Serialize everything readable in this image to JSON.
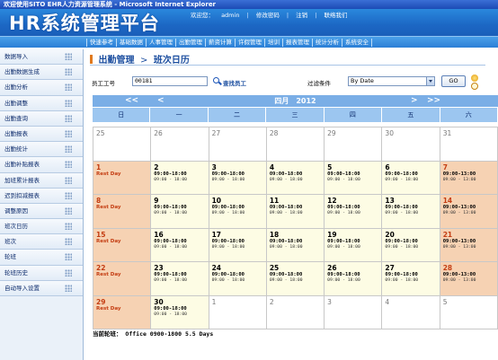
{
  "window": {
    "title": "欢迎使用SITO EHR人力资源管理系统 - Microsoft Internet Explorer"
  },
  "header": {
    "logo": "HR系统管理平台",
    "welcome_label": "欢迎您：",
    "user": "admin",
    "links": [
      "修改密码",
      "注销",
      "联络我们"
    ]
  },
  "nav": [
    "快速参考",
    "基础数据",
    "人事管理",
    "出勤管理",
    "薪资计算",
    "许假管理",
    "培训",
    "报表管理",
    "统计分析",
    "系统安全"
  ],
  "sidebar": [
    "数据导入",
    "出勤数据生成",
    "出勤分析",
    "出勤调整",
    "出勤查询",
    "出勤报表",
    "出勤统计",
    "出勤补贴报表",
    "加班累计报表",
    "迟到扣减报表",
    "调整原因",
    "班次日历",
    "班次",
    "轮班",
    "轮班历史",
    "自动导入设置"
  ],
  "breadcrumb": {
    "section": "出勤管理",
    "sep": ">",
    "page": "班次日历"
  },
  "filter": {
    "emp_label": "员工工号",
    "emp_value": "00181",
    "search_link": "查找员工",
    "cond_label": "过滤条件",
    "cond_value": "By Date",
    "go_label": "GO"
  },
  "calendar": {
    "prev_year": "<<",
    "prev_month": "<",
    "next_month": ">",
    "next_year": ">>",
    "title": "四月　2012",
    "weekdays": [
      "日",
      "一",
      "二",
      "三",
      "四",
      "五",
      "六"
    ],
    "weeks": [
      [
        {
          "d": "25",
          "t": "other"
        },
        {
          "d": "26",
          "t": "other"
        },
        {
          "d": "27",
          "t": "other"
        },
        {
          "d": "28",
          "t": "other"
        },
        {
          "d": "29",
          "t": "other"
        },
        {
          "d": "30",
          "t": "other"
        },
        {
          "d": "31",
          "t": "other"
        }
      ],
      [
        {
          "d": "1",
          "t": "rest",
          "l": "Rest Day"
        },
        {
          "d": "2",
          "t": "work",
          "s1": "09:00-18:00",
          "s2": "09:00 - 18:00"
        },
        {
          "d": "3",
          "t": "work",
          "s1": "09:00-18:00",
          "s2": "09:00 - 18:00"
        },
        {
          "d": "4",
          "t": "work",
          "s1": "09:00-18:00",
          "s2": "09:00 - 18:00"
        },
        {
          "d": "5",
          "t": "work",
          "s1": "09:00-18:00",
          "s2": "09:00 - 18:00"
        },
        {
          "d": "6",
          "t": "work",
          "s1": "09:00-18:00",
          "s2": "09:00 - 18:00"
        },
        {
          "d": "7",
          "t": "rest",
          "s1": "09:00-13:00",
          "s2": "09:00 - 13:00"
        }
      ],
      [
        {
          "d": "8",
          "t": "rest",
          "l": "Rest Day"
        },
        {
          "d": "9",
          "t": "work",
          "s1": "09:00-18:00",
          "s2": "09:00 - 18:00"
        },
        {
          "d": "10",
          "t": "work",
          "s1": "09:00-18:00",
          "s2": "09:00 - 18:00"
        },
        {
          "d": "11",
          "t": "work",
          "s1": "09:00-18:00",
          "s2": "09:00 - 18:00"
        },
        {
          "d": "12",
          "t": "work",
          "s1": "09:00-18:00",
          "s2": "09:00 - 18:00"
        },
        {
          "d": "13",
          "t": "work",
          "s1": "09:00-18:00",
          "s2": "09:00 - 18:00"
        },
        {
          "d": "14",
          "t": "rest",
          "s1": "09:00-13:00",
          "s2": "09:00 - 13:00"
        }
      ],
      [
        {
          "d": "15",
          "t": "rest",
          "l": "Rest Day"
        },
        {
          "d": "16",
          "t": "work",
          "s1": "09:00-18:00",
          "s2": "09:00 - 18:00"
        },
        {
          "d": "17",
          "t": "work",
          "s1": "09:00-18:00",
          "s2": "09:00 - 18:00"
        },
        {
          "d": "18",
          "t": "work",
          "s1": "09:00-18:00",
          "s2": "09:00 - 18:00"
        },
        {
          "d": "19",
          "t": "work",
          "s1": "09:00-18:00",
          "s2": "09:00 - 18:00"
        },
        {
          "d": "20",
          "t": "work",
          "s1": "09:00-18:00",
          "s2": "09:00 - 18:00"
        },
        {
          "d": "21",
          "t": "rest",
          "s1": "09:00-13:00",
          "s2": "09:00 - 13:00"
        }
      ],
      [
        {
          "d": "22",
          "t": "rest",
          "l": "Rest Day"
        },
        {
          "d": "23",
          "t": "work",
          "s1": "09:00-18:00",
          "s2": "09:00 - 18:00"
        },
        {
          "d": "24",
          "t": "work",
          "s1": "09:00-18:00",
          "s2": "09:00 - 18:00"
        },
        {
          "d": "25",
          "t": "work",
          "s1": "09:00-18:00",
          "s2": "09:00 - 18:00"
        },
        {
          "d": "26",
          "t": "work",
          "s1": "09:00-18:00",
          "s2": "09:00 - 18:00"
        },
        {
          "d": "27",
          "t": "work",
          "s1": "09:00-18:00",
          "s2": "09:00 - 18:00"
        },
        {
          "d": "28",
          "t": "rest",
          "s1": "09:00-13:00",
          "s2": "09:00 - 13:00"
        }
      ],
      [
        {
          "d": "29",
          "t": "rest",
          "l": "Rest Day"
        },
        {
          "d": "30",
          "t": "work",
          "s1": "09:00-18:00",
          "s2": "09:00 - 18:00"
        },
        {
          "d": "1",
          "t": "other"
        },
        {
          "d": "2",
          "t": "other"
        },
        {
          "d": "3",
          "t": "other"
        },
        {
          "d": "4",
          "t": "other"
        },
        {
          "d": "5",
          "t": "other"
        }
      ]
    ]
  },
  "current_shift": "当前轮班： Office 0900-1800 5.5 Days",
  "colors": {
    "header": "#1c67c4",
    "rest_day": "#f6d2b3",
    "work_day": "#fdfce4",
    "weekday_header": "#9cc6f0"
  }
}
